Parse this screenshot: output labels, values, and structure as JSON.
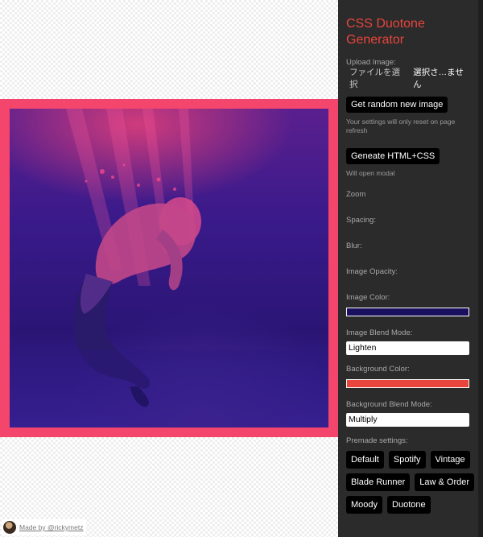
{
  "sidebar": {
    "title": "CSS Duotone Generator",
    "upload_label": "Upload Image:",
    "file_button": "ファイルを選択",
    "file_status": "選択さ…ません",
    "random_button": "Get random new image",
    "reset_note": "Your settings will only reset on page refresh",
    "generate_button": "Geneate HTML+CSS",
    "modal_note": "Will open modal",
    "zoom_label": "Zoom",
    "spacing_label": "Spacing:",
    "blur_label": "Blur:",
    "image_opacity_label": "Image Opacity:",
    "image_color_label": "Image Color:",
    "image_color": "#1a1060",
    "image_blend_label": "Image Blend Mode:",
    "image_blend_value": "Lighten",
    "bg_color_label": "Background Color:",
    "bg_color": "#e8453c",
    "bg_blend_label": "Background Blend Mode:",
    "bg_blend_value": "Multiply",
    "premade_label": "Premade settings:",
    "presets": [
      "Default",
      "Spotify",
      "Vintage",
      "Blade Runner",
      "Law & Order",
      "Moody",
      "Duotone"
    ]
  },
  "preview": {
    "frame_color": "#f4456c"
  },
  "credit": {
    "text": "Made by @rickymetz"
  }
}
